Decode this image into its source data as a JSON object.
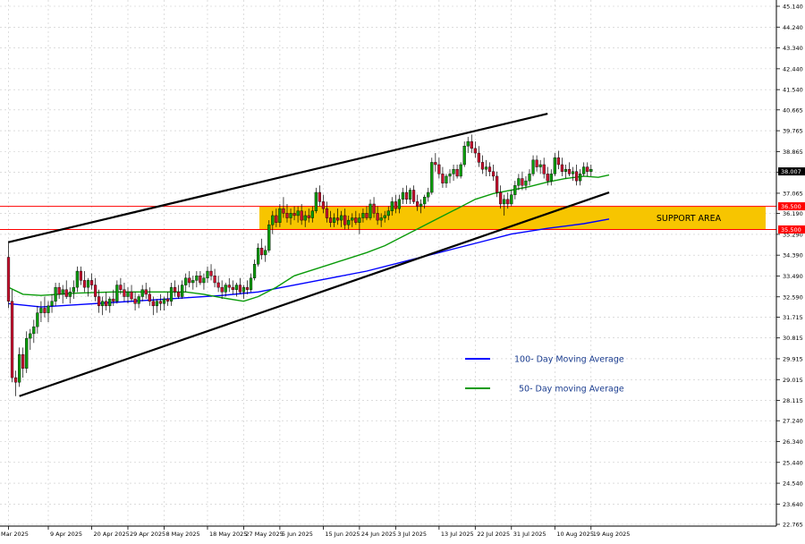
{
  "chart_data": {
    "type": "candlestick",
    "y_ticks": [
      "45.140",
      "44.240",
      "43.340",
      "42.440",
      "41.540",
      "40.665",
      "39.765",
      "38.865",
      "37.965",
      "37.065",
      "36.190",
      "35.290",
      "34.390",
      "33.490",
      "32.590",
      "31.715",
      "30.815",
      "29.915",
      "29.015",
      "28.115",
      "27.240",
      "26.340",
      "25.440",
      "24.540",
      "23.640",
      "22.765"
    ],
    "y_tick_values": [
      45.14,
      44.24,
      43.34,
      42.44,
      41.54,
      40.665,
      39.765,
      38.865,
      37.965,
      37.065,
      36.19,
      35.29,
      34.39,
      33.49,
      32.59,
      31.715,
      30.815,
      29.915,
      29.015,
      28.115,
      27.24,
      26.34,
      25.44,
      24.54,
      23.64,
      22.765
    ],
    "x_ticks": [
      "Mar 2025",
      "9 Apr 2025",
      "20 Apr 2025",
      "29 Apr 2025",
      "8 May 2025",
      "18 May 2025",
      "27 May 2025",
      "5 Jun 2025",
      "15 Jun 2025",
      "24 Jun 2025",
      "3 Jul 2025",
      "13 Jul 2025",
      "22 Jul 2025",
      "31 Jul 2025",
      "10 Aug 2025",
      "19 Aug 2025"
    ],
    "x_tick_index": [
      1,
      12,
      24,
      34,
      44,
      56,
      66,
      76,
      88,
      98,
      108,
      120,
      130,
      140,
      152,
      162
    ],
    "ylim": [
      22.765,
      45.14
    ],
    "n_bars": 167,
    "current_price": "38.007",
    "current_value": 38.007,
    "support_area": {
      "label": "SUPPORT AREA",
      "upper": 36.5,
      "lower": 35.5,
      "upper_label": "36.500",
      "lower_label": "35.500"
    },
    "channel": {
      "upper": [
        [
          1,
          34.95
        ],
        [
          150,
          40.5
        ]
      ],
      "lower": [
        [
          4,
          28.3
        ],
        [
          167,
          37.1
        ]
      ]
    },
    "candles": [
      [
        34.3,
        35.0,
        32.1,
        32.4
      ],
      [
        32.4,
        32.9,
        28.9,
        29.1
      ],
      [
        29.1,
        29.4,
        28.3,
        28.9
      ],
      [
        28.9,
        30.4,
        28.7,
        30.1
      ],
      [
        30.1,
        30.4,
        29.1,
        29.5
      ],
      [
        29.5,
        31.1,
        29.3,
        30.8
      ],
      [
        30.8,
        31.2,
        30.3,
        31.0
      ],
      [
        31.0,
        31.6,
        30.6,
        31.3
      ],
      [
        31.3,
        32.2,
        31.0,
        31.9
      ],
      [
        31.9,
        32.4,
        31.5,
        32.1
      ],
      [
        32.1,
        32.6,
        31.7,
        31.9
      ],
      [
        31.9,
        32.4,
        31.5,
        32.2
      ],
      [
        32.2,
        32.7,
        31.9,
        32.4
      ],
      [
        32.4,
        33.2,
        32.2,
        33.0
      ],
      [
        33.0,
        33.2,
        32.5,
        32.7
      ],
      [
        32.7,
        33.1,
        32.3,
        32.9
      ],
      [
        32.9,
        33.3,
        32.5,
        32.6
      ],
      [
        32.6,
        33.0,
        32.3,
        32.8
      ],
      [
        32.8,
        33.3,
        32.5,
        33.0
      ],
      [
        33.0,
        33.9,
        32.8,
        33.7
      ],
      [
        33.7,
        33.9,
        33.1,
        33.3
      ],
      [
        33.3,
        33.7,
        32.8,
        33.0
      ],
      [
        33.0,
        33.4,
        32.6,
        33.3
      ],
      [
        33.3,
        33.6,
        32.9,
        33.1
      ],
      [
        33.1,
        33.4,
        32.4,
        32.6
      ],
      [
        32.6,
        32.9,
        31.9,
        32.2
      ],
      [
        32.2,
        32.6,
        31.8,
        32.4
      ],
      [
        32.4,
        32.8,
        32.0,
        32.2
      ],
      [
        32.2,
        32.6,
        31.9,
        32.5
      ],
      [
        32.5,
        32.9,
        32.2,
        32.4
      ],
      [
        32.4,
        33.3,
        32.3,
        33.1
      ],
      [
        33.1,
        33.4,
        32.7,
        32.9
      ],
      [
        32.9,
        33.2,
        32.4,
        32.6
      ],
      [
        32.6,
        33.0,
        32.3,
        32.8
      ],
      [
        32.8,
        33.1,
        32.4,
        32.5
      ],
      [
        32.5,
        32.8,
        32.0,
        32.3
      ],
      [
        32.3,
        32.7,
        32.1,
        32.6
      ],
      [
        32.6,
        33.1,
        32.4,
        32.9
      ],
      [
        32.9,
        33.2,
        32.5,
        32.7
      ],
      [
        32.7,
        33.0,
        32.2,
        32.4
      ],
      [
        32.4,
        32.6,
        31.8,
        32.2
      ],
      [
        32.2,
        32.5,
        31.9,
        32.4
      ],
      [
        32.4,
        32.7,
        32.0,
        32.3
      ],
      [
        32.3,
        32.6,
        32.0,
        32.5
      ],
      [
        32.5,
        32.8,
        32.2,
        32.4
      ],
      [
        32.4,
        33.2,
        32.2,
        33.0
      ],
      [
        33.0,
        33.3,
        32.6,
        32.8
      ],
      [
        32.8,
        33.1,
        32.5,
        32.6
      ],
      [
        32.6,
        33.3,
        32.5,
        33.1
      ],
      [
        33.1,
        33.6,
        32.8,
        33.4
      ],
      [
        33.4,
        33.7,
        33.0,
        33.2
      ],
      [
        33.2,
        33.5,
        32.9,
        33.3
      ],
      [
        33.3,
        33.7,
        33.0,
        33.5
      ],
      [
        33.5,
        33.7,
        33.1,
        33.2
      ],
      [
        33.2,
        33.6,
        32.9,
        33.4
      ],
      [
        33.4,
        33.9,
        33.2,
        33.7
      ],
      [
        33.7,
        34.0,
        33.3,
        33.5
      ],
      [
        33.5,
        33.8,
        33.0,
        33.2
      ],
      [
        33.2,
        33.5,
        32.8,
        33.0
      ],
      [
        33.0,
        33.3,
        32.5,
        32.8
      ],
      [
        32.8,
        33.2,
        32.6,
        33.1
      ],
      [
        33.1,
        33.4,
        32.8,
        33.0
      ],
      [
        33.0,
        33.3,
        32.7,
        32.9
      ],
      [
        32.9,
        33.2,
        32.6,
        33.1
      ],
      [
        33.1,
        33.4,
        32.7,
        32.8
      ],
      [
        32.8,
        33.1,
        32.5,
        33.0
      ],
      [
        33.0,
        33.3,
        32.7,
        32.9
      ],
      [
        32.9,
        33.6,
        32.8,
        33.4
      ],
      [
        33.4,
        34.2,
        33.3,
        34.0
      ],
      [
        34.0,
        34.9,
        33.9,
        34.7
      ],
      [
        34.7,
        35.1,
        34.2,
        34.4
      ],
      [
        34.4,
        34.8,
        34.1,
        34.6
      ],
      [
        34.6,
        35.9,
        34.5,
        35.7
      ],
      [
        35.7,
        36.3,
        35.3,
        36.1
      ],
      [
        36.1,
        36.4,
        35.6,
        35.8
      ],
      [
        35.8,
        36.6,
        35.6,
        36.4
      ],
      [
        36.4,
        36.9,
        36.0,
        36.2
      ],
      [
        36.2,
        36.6,
        35.8,
        36.0
      ],
      [
        36.0,
        36.4,
        35.7,
        36.2
      ],
      [
        36.2,
        36.5,
        35.9,
        36.1
      ],
      [
        36.1,
        36.5,
        35.8,
        36.3
      ],
      [
        36.3,
        36.6,
        35.7,
        35.9
      ],
      [
        35.9,
        36.3,
        35.6,
        36.1
      ],
      [
        36.1,
        36.4,
        35.8,
        36.0
      ],
      [
        36.0,
        36.5,
        35.8,
        36.3
      ],
      [
        36.3,
        37.3,
        36.2,
        37.1
      ],
      [
        37.1,
        37.4,
        36.5,
        36.7
      ],
      [
        36.7,
        37.0,
        36.2,
        36.4
      ],
      [
        36.4,
        36.7,
        35.8,
        36.0
      ],
      [
        36.0,
        36.3,
        35.6,
        35.8
      ],
      [
        35.8,
        36.2,
        35.6,
        36.0
      ],
      [
        36.0,
        36.4,
        35.7,
        35.9
      ],
      [
        35.9,
        36.3,
        35.6,
        36.1
      ],
      [
        36.1,
        36.4,
        35.5,
        35.7
      ],
      [
        35.7,
        36.1,
        35.5,
        35.9
      ],
      [
        35.9,
        36.2,
        35.6,
        36.0
      ],
      [
        36.0,
        36.3,
        35.7,
        35.8
      ],
      [
        35.8,
        36.2,
        35.3,
        36.0
      ],
      [
        36.0,
        36.4,
        35.8,
        36.2
      ],
      [
        36.2,
        36.5,
        35.9,
        36.0
      ],
      [
        36.0,
        36.8,
        35.9,
        36.6
      ],
      [
        36.6,
        36.9,
        36.0,
        36.2
      ],
      [
        36.2,
        36.5,
        35.7,
        35.9
      ],
      [
        35.9,
        36.2,
        35.6,
        36.0
      ],
      [
        36.0,
        36.3,
        35.8,
        36.1
      ],
      [
        36.1,
        36.5,
        35.9,
        36.3
      ],
      [
        36.3,
        36.9,
        36.1,
        36.7
      ],
      [
        36.7,
        37.0,
        36.2,
        36.4
      ],
      [
        36.4,
        37.0,
        36.2,
        36.8
      ],
      [
        36.8,
        37.3,
        36.6,
        37.1
      ],
      [
        37.1,
        37.4,
        36.6,
        36.8
      ],
      [
        36.8,
        37.3,
        36.6,
        37.2
      ],
      [
        37.2,
        37.4,
        36.6,
        36.7
      ],
      [
        36.7,
        37.0,
        36.3,
        36.5
      ],
      [
        36.5,
        36.8,
        36.2,
        36.6
      ],
      [
        36.6,
        37.0,
        36.4,
        36.9
      ],
      [
        36.9,
        37.3,
        36.7,
        37.1
      ],
      [
        37.1,
        38.6,
        37.0,
        38.4
      ],
      [
        38.4,
        38.8,
        38.0,
        38.3
      ],
      [
        38.3,
        38.6,
        37.7,
        37.9
      ],
      [
        37.9,
        38.2,
        37.3,
        37.5
      ],
      [
        37.5,
        37.9,
        37.3,
        37.8
      ],
      [
        37.8,
        38.1,
        37.5,
        37.9
      ],
      [
        37.9,
        38.3,
        37.6,
        38.1
      ],
      [
        38.1,
        38.3,
        37.7,
        37.8
      ],
      [
        37.8,
        38.4,
        37.7,
        38.3
      ],
      [
        38.3,
        39.3,
        38.2,
        39.1
      ],
      [
        39.1,
        39.5,
        38.8,
        39.3
      ],
      [
        39.3,
        39.6,
        38.8,
        39.0
      ],
      [
        39.0,
        39.3,
        38.6,
        38.8
      ],
      [
        38.8,
        39.1,
        38.2,
        38.4
      ],
      [
        38.4,
        38.7,
        37.9,
        38.1
      ],
      [
        38.1,
        38.5,
        37.8,
        38.2
      ],
      [
        38.2,
        38.4,
        37.8,
        38.0
      ],
      [
        38.0,
        38.3,
        37.6,
        37.8
      ],
      [
        37.8,
        38.0,
        36.9,
        37.1
      ],
      [
        37.1,
        37.4,
        36.4,
        36.6
      ],
      [
        36.6,
        37.0,
        36.1,
        36.8
      ],
      [
        36.8,
        37.1,
        36.4,
        36.6
      ],
      [
        36.6,
        37.2,
        36.5,
        37.0
      ],
      [
        37.0,
        37.6,
        36.8,
        37.4
      ],
      [
        37.4,
        37.9,
        37.2,
        37.7
      ],
      [
        37.7,
        38.0,
        37.2,
        37.4
      ],
      [
        37.4,
        37.8,
        37.2,
        37.6
      ],
      [
        37.6,
        38.1,
        37.4,
        37.9
      ],
      [
        37.9,
        38.7,
        37.8,
        38.5
      ],
      [
        38.5,
        38.7,
        38.0,
        38.2
      ],
      [
        38.2,
        38.5,
        37.9,
        38.3
      ],
      [
        38.3,
        38.6,
        37.7,
        37.9
      ],
      [
        37.9,
        38.2,
        37.4,
        37.6
      ],
      [
        37.6,
        38.1,
        37.4,
        37.9
      ],
      [
        37.9,
        38.8,
        37.8,
        38.6
      ],
      [
        38.6,
        38.9,
        38.1,
        38.3
      ],
      [
        38.3,
        38.6,
        37.8,
        38.0
      ],
      [
        38.0,
        38.3,
        37.7,
        38.1
      ],
      [
        38.1,
        38.4,
        37.8,
        37.9
      ],
      [
        37.9,
        38.2,
        37.6,
        38.0
      ],
      [
        38.0,
        38.3,
        37.4,
        37.6
      ],
      [
        37.6,
        38.1,
        37.4,
        37.9
      ],
      [
        37.9,
        38.4,
        37.8,
        38.2
      ],
      [
        38.2,
        38.4,
        37.8,
        38.0
      ],
      [
        38.0,
        38.3,
        37.8,
        38.1
      ]
    ],
    "ma50": [
      [
        1,
        33.0
      ],
      [
        5,
        32.7
      ],
      [
        10,
        32.65
      ],
      [
        20,
        32.75
      ],
      [
        30,
        32.8
      ],
      [
        40,
        32.8
      ],
      [
        50,
        32.8
      ],
      [
        55,
        32.7
      ],
      [
        60,
        32.55
      ],
      [
        66,
        32.4
      ],
      [
        70,
        32.6
      ],
      [
        75,
        33.0
      ],
      [
        80,
        33.5
      ],
      [
        90,
        34.0
      ],
      [
        100,
        34.5
      ],
      [
        105,
        34.8
      ],
      [
        110,
        35.2
      ],
      [
        115,
        35.6
      ],
      [
        120,
        36.0
      ],
      [
        125,
        36.4
      ],
      [
        130,
        36.8
      ],
      [
        135,
        37.05
      ],
      [
        140,
        37.2
      ],
      [
        145,
        37.35
      ],
      [
        150,
        37.55
      ],
      [
        155,
        37.7
      ],
      [
        160,
        37.8
      ],
      [
        164,
        37.75
      ],
      [
        167,
        37.85
      ]
    ],
    "ma100": [
      [
        1,
        32.3
      ],
      [
        10,
        32.15
      ],
      [
        20,
        32.25
      ],
      [
        30,
        32.35
      ],
      [
        40,
        32.45
      ],
      [
        50,
        32.55
      ],
      [
        60,
        32.65
      ],
      [
        70,
        32.8
      ],
      [
        80,
        33.1
      ],
      [
        90,
        33.4
      ],
      [
        100,
        33.7
      ],
      [
        110,
        34.1
      ],
      [
        120,
        34.5
      ],
      [
        130,
        34.9
      ],
      [
        140,
        35.3
      ],
      [
        150,
        35.55
      ],
      [
        160,
        35.75
      ],
      [
        167,
        35.95
      ]
    ],
    "legend": [
      {
        "label": "100- Day Moving Average",
        "color": "#0000ff"
      },
      {
        "label": "50- Day moving Average",
        "color": "#0a9b0a"
      }
    ],
    "colors": {
      "bull": "#0a9b0a",
      "bear": "#c8102e",
      "ma50": "#0a9b0a",
      "ma100": "#0000ff",
      "channel": "#000000",
      "support_fill": "#f7c500",
      "support_line": "#ff0000",
      "price_tag": "#000000"
    }
  }
}
